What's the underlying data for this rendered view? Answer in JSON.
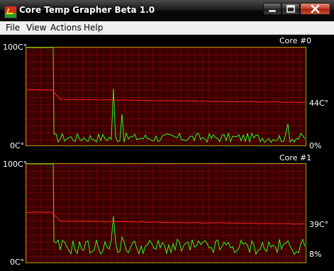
{
  "window": {
    "title": "Core Temp Grapher Beta 1.0"
  },
  "menu": {
    "file": "File",
    "view": "View",
    "actions": "Actions",
    "help": "Help"
  },
  "graphs": [
    {
      "core_label": "Core #0",
      "y_max_label": "100C°",
      "y_min_label": "0C°",
      "temp_label": "44C°",
      "load_label": "0%",
      "colors": {
        "temp": "#ff2020",
        "load": "#22ff22",
        "grid": "#6e0000",
        "frame": "#a8a000",
        "bg": "#3a0000"
      },
      "temp_start": 57,
      "temp_end": 44,
      "load_spike": 58,
      "load_baseline": 3
    },
    {
      "core_label": "Core #1",
      "y_max_label": "100C°",
      "y_min_label": "0C°",
      "temp_label": "39C°",
      "load_label": "8%",
      "colors": {
        "temp": "#ff2020",
        "load": "#22ff22",
        "grid": "#6e0000",
        "frame": "#a8a000",
        "bg": "#3a0000"
      },
      "temp_start": 51,
      "temp_end": 39,
      "load_spike": 47,
      "load_baseline": 8
    }
  ]
}
